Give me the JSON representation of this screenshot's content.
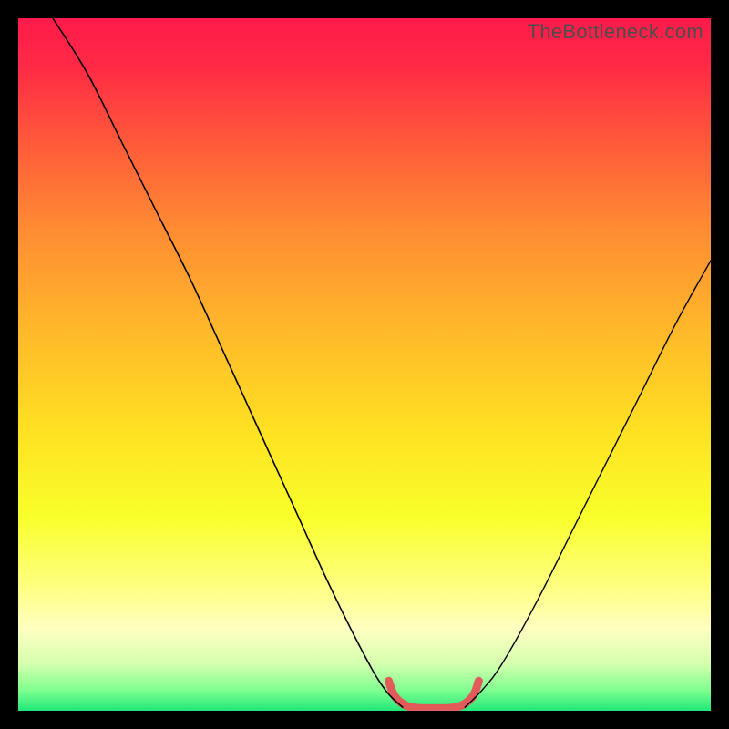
{
  "watermark": "TheBottleneck.com",
  "gradient": {
    "stops": [
      {
        "pos": 0.0,
        "color": "#ff1a4b"
      },
      {
        "pos": 0.07,
        "color": "#ff2a45"
      },
      {
        "pos": 0.18,
        "color": "#ff5a3a"
      },
      {
        "pos": 0.3,
        "color": "#ff8a33"
      },
      {
        "pos": 0.45,
        "color": "#ffb82a"
      },
      {
        "pos": 0.6,
        "color": "#ffe222"
      },
      {
        "pos": 0.72,
        "color": "#f8ff2a"
      },
      {
        "pos": 0.82,
        "color": "#ffff80"
      },
      {
        "pos": 0.88,
        "color": "#ffffc0"
      },
      {
        "pos": 0.93,
        "color": "#d8ffb0"
      },
      {
        "pos": 0.97,
        "color": "#80ff90"
      },
      {
        "pos": 1.0,
        "color": "#20e878"
      }
    ]
  },
  "chart_data": {
    "type": "line",
    "title": "",
    "xlabel": "",
    "ylabel": "",
    "xlim": [
      0,
      100
    ],
    "ylim": [
      0,
      100
    ],
    "series": [
      {
        "name": "left-curve",
        "x": [
          5,
          10,
          15,
          20,
          25,
          30,
          35,
          40,
          45,
          50,
          53,
          55.5
        ],
        "y": [
          100,
          92,
          82,
          72,
          62,
          51,
          40,
          29,
          18,
          8,
          3,
          0.5
        ],
        "color": "#000000",
        "width": 1.6
      },
      {
        "name": "right-curve",
        "x": [
          64.5,
          67,
          70,
          75,
          80,
          85,
          90,
          95,
          100
        ],
        "y": [
          0.5,
          3,
          7,
          16,
          26,
          36,
          46,
          56,
          65
        ],
        "color": "#000000",
        "width": 1.4
      },
      {
        "name": "bottom-red-accent",
        "x": [
          53.5,
          54.3,
          55.7,
          57.5,
          60,
          62.5,
          64.3,
          65.7,
          66.5
        ],
        "y": [
          4.3,
          2.2,
          0.9,
          0.4,
          0.35,
          0.4,
          0.9,
          2.2,
          4.3
        ],
        "color": "#e25a5a",
        "width": 9
      }
    ]
  }
}
